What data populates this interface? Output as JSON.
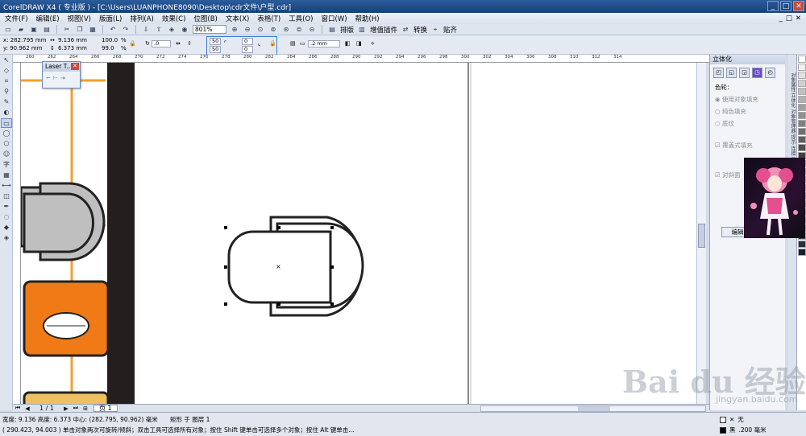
{
  "app": {
    "title": "CorelDRAW X4 ( 专业版 ) - [C:\\Users\\LUANPHONE8090\\Desktop\\cdr文件\\户型.cdr]"
  },
  "window_controls": [
    "_",
    "□",
    "✕"
  ],
  "menu": [
    "文件(F)",
    "编辑(E)",
    "视图(V)",
    "版面(L)",
    "排列(A)",
    "效果(C)",
    "位图(B)",
    "文本(X)",
    "表格(T)",
    "工具(O)",
    "窗口(W)",
    "帮助(H)"
  ],
  "mdi_controls": [
    "_",
    "□",
    "✕"
  ],
  "toolbar": {
    "zoom": "801%",
    "buttons": [
      "排版",
      "增值插件",
      "转换",
      "贴齐"
    ]
  },
  "propbar": {
    "x": "x: 282.795 mm",
    "y": "y: 90.962 mm",
    "w": "9.136 mm",
    "h": "6.373 mm",
    "sx": "100.0",
    "sy": "99.0",
    "pct": "%",
    "angle": ".0",
    "c1": "50",
    "c2": "50",
    "c3": "0",
    "c4": "0",
    "outline": ".2 mm"
  },
  "ruler": {
    "ticks": [
      "260",
      "262",
      "264",
      "266",
      "268",
      "270",
      "272",
      "274",
      "276",
      "278",
      "280",
      "282",
      "284",
      "286",
      "288",
      "290",
      "292",
      "294",
      "296",
      "298",
      "300",
      "302",
      "304",
      "306",
      "308",
      "310",
      "312",
      "314"
    ]
  },
  "colors": {
    "orange": "#f07a16",
    "dark": "#231f1e",
    "grey": "#bfbfbf",
    "grid": "#f0a030",
    "accent": "#3a7bd0"
  },
  "laser_tool": {
    "title": "Laser T..."
  },
  "docker": {
    "title": "立体化",
    "section": "色轮：",
    "opt1": "使用对象填充",
    "opt2": "纯色填充",
    "opt3": "底纹",
    "chk1": "覆盖式填充",
    "chk2": "对斜面",
    "button": "编辑"
  },
  "side_tab": "对象属性  立体化  对象管理器  提示  连接  导入",
  "pagebar": {
    "count": "1 / 1",
    "tab": "页 1"
  },
  "status": {
    "line1": "宽度: 9.136  高度: 6.373  中心: (282.795, 90.962)  毫米",
    "line1b": "矩形 于 图层 1",
    "line2": "( 290.423, 94.003 ) 单击对象两次可旋转/倾斜；双击工具可选择所有对象；按住 Shift 键单击可选择多个对象；按住 Alt 键单击...",
    "fill": "无",
    "outline_color": "黑",
    "outline_width": ".200 毫米"
  },
  "watermark": {
    "brand": "Bai du 经验",
    "url": "jingyan.baidu.com"
  }
}
